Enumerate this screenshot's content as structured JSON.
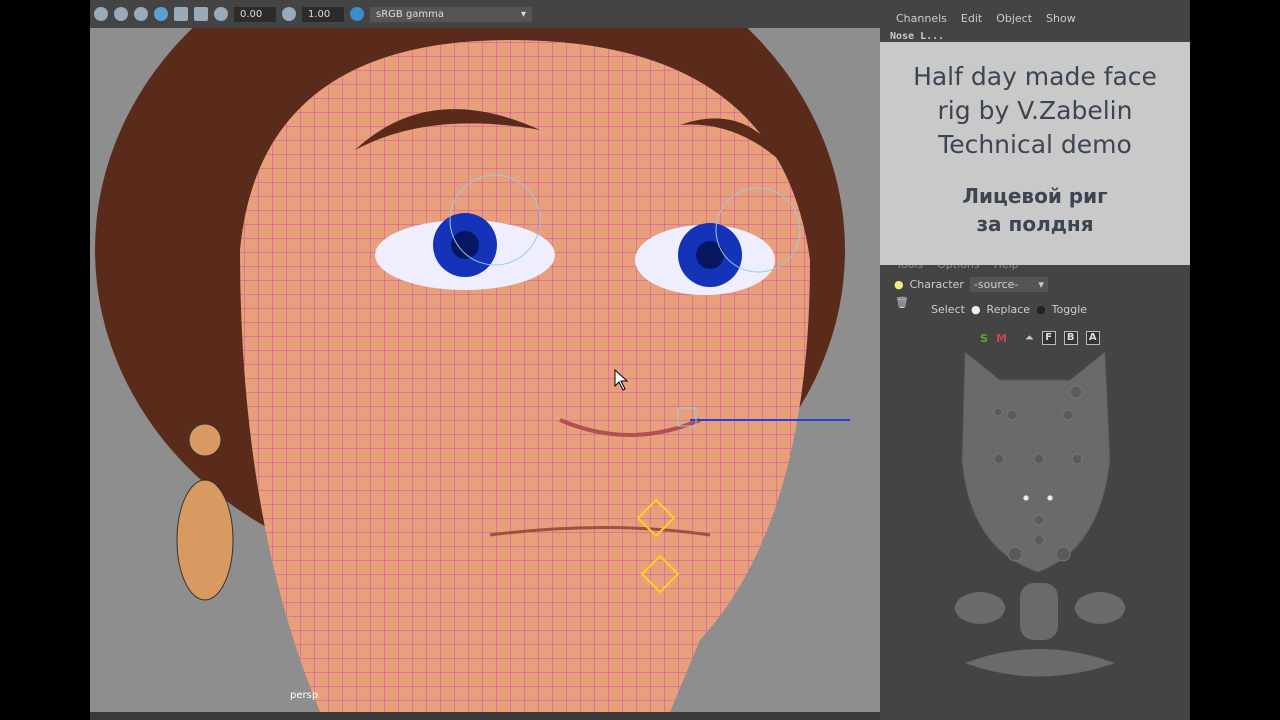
{
  "toolbar": {
    "exposure": "0.00",
    "gamma": "1.00",
    "color_space": "sRGB gamma"
  },
  "viewport": {
    "camera": "persp"
  },
  "channel_box": {
    "menus": [
      "Channels",
      "Edit",
      "Object",
      "Show"
    ],
    "selected_node": "Nose L..."
  },
  "overlay": {
    "title_lines": [
      "Half day made face",
      "rig by V.Zabelin",
      "Technical demo"
    ],
    "subtitle_lines": [
      "Лицевой риг",
      "за полдня"
    ]
  },
  "picker": {
    "menus": [
      "Tools",
      "Options",
      "Help"
    ],
    "character_label": "Character",
    "character_value": "-source-",
    "select_label": "Select",
    "replace_label": "Replace",
    "toggle_label": "Toggle",
    "buttons": [
      "S",
      "M",
      "F",
      "B",
      "A"
    ]
  }
}
